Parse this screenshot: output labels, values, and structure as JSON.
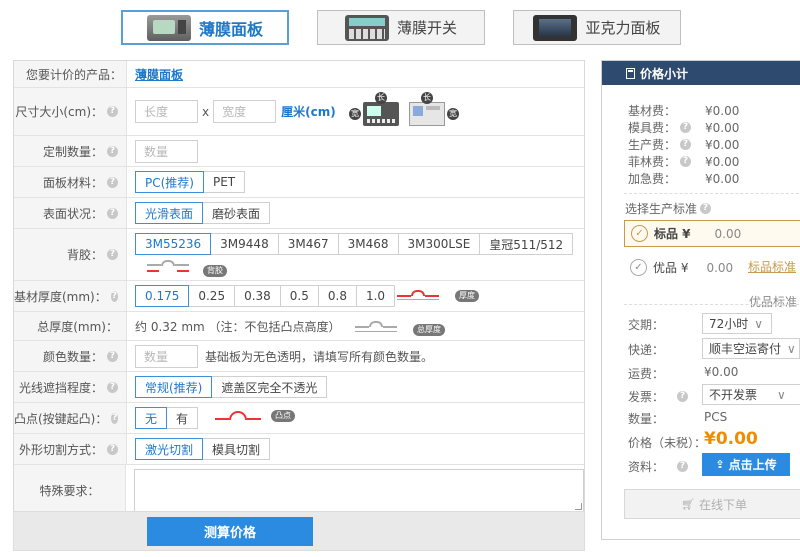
{
  "tabs": [
    {
      "label": "薄膜面板",
      "active": true
    },
    {
      "label": "薄膜开关",
      "active": false
    },
    {
      "label": "亚克力面板",
      "active": false
    }
  ],
  "form": {
    "product": {
      "label": "您要计价的产品：",
      "value": "薄膜面板"
    },
    "size": {
      "label": "尺寸大小(cm)：",
      "length_placeholder": "长度",
      "separator": "x",
      "width_placeholder": "宽度",
      "unit": "厘米(cm)",
      "dim_long": "长",
      "dim_wide": "宽"
    },
    "quantity": {
      "label": "定制数量：",
      "placeholder": "数量"
    },
    "material": {
      "label": "面板材料：",
      "options": [
        "PC(推荐)",
        "PET"
      ]
    },
    "surface": {
      "label": "表面状况：",
      "options": [
        "光滑表面",
        "磨砂表面"
      ]
    },
    "adhesive": {
      "label": "背胶：",
      "options": [
        "3M55236",
        "3M9448",
        "3M467",
        "3M468",
        "3M300LSE",
        "皇冠511/512"
      ],
      "tag": "背胶"
    },
    "thickness": {
      "label": "基材厚度(mm)：",
      "options": [
        "0.175",
        "0.25",
        "0.38",
        "0.5",
        "0.8",
        "1.0"
      ],
      "tag": "厚度"
    },
    "total_thickness": {
      "label": "总厚度(mm)：",
      "text": "约 0.32 mm （注：不包括凸点高度）",
      "tag": "总厚度"
    },
    "colors": {
      "label": "颜色数量：",
      "placeholder": "数量",
      "note": "基础板为无色透明，请填写所有颜色数量。"
    },
    "light": {
      "label": "光线遮挡程度：",
      "options": [
        "常规(推荐)",
        "遮盖区完全不透光"
      ]
    },
    "bump": {
      "label": "凸点(按键起凸)：",
      "options": [
        "无",
        "有"
      ],
      "tag": "凸点"
    },
    "cutting": {
      "label": "外形切割方式：",
      "options": [
        "激光切割",
        "模具切割"
      ]
    },
    "special": {
      "label": "特殊要求："
    },
    "calc_button": "测算价格"
  },
  "panel": {
    "title": "价格小计",
    "fees": [
      {
        "label": "基材费：",
        "value": "¥0.00",
        "help": false
      },
      {
        "label": "模具费：",
        "value": "¥0.00",
        "help": true
      },
      {
        "label": "生产费：",
        "value": "¥0.00",
        "help": true
      },
      {
        "label": "菲林费：",
        "value": "¥0.00",
        "help": true
      },
      {
        "label": "加急费：",
        "value": "¥0.00",
        "help": false
      }
    ],
    "standard_title": "选择生产标准",
    "standard": {
      "label": "标品 ¥",
      "value": "0.00",
      "tooltip": "标品标准"
    },
    "premium": {
      "label": "优品 ¥",
      "value": "0.00",
      "tooltip": "优品标准"
    },
    "delivery_label": "交期：",
    "delivery_value": "72小时",
    "shipping_label": "快递：",
    "shipping_value": "顺丰空运寄付",
    "freight_label": "运费：",
    "freight_value": "¥0.00",
    "invoice_label": "发票：",
    "invoice_value": "不开发票",
    "qty_label": "数量：",
    "qty_value": "PCS",
    "price_label": "价格（未税）：",
    "price_value": "¥0.00",
    "file_label": "资料：",
    "upload_label": "点击上传",
    "order_label": "在线下单"
  },
  "colors": {
    "accent": "#2a8be0",
    "header": "#2e4a6e",
    "price": "#f08c00",
    "gold": "#c79a4f"
  }
}
